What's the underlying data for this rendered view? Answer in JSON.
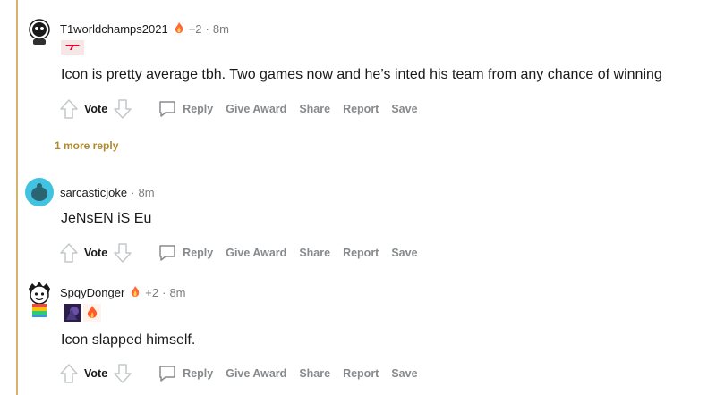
{
  "colors": {
    "thread_line": "#d6b46e",
    "more_reply": "#b08a2d",
    "meta_gray": "#7c7c7c",
    "action_gray": "#878a8c"
  },
  "comments": [
    {
      "username": "T1worldchamps2021",
      "award_icon": "fire-award-icon",
      "award_count": "+2",
      "time": "8m",
      "flair": [
        "t1-logo-flair-icon"
      ],
      "body": "Icon is pretty average tbh. Two games now and he’s inted his team from any chance of winning"
    },
    {
      "username": "sarcasticjoke",
      "time": "8m",
      "body": "JeNsEN iS Eu"
    },
    {
      "username": "SpqyDonger",
      "award_icon": "fire-award-icon",
      "award_count": "+2",
      "time": "8m",
      "flair": [
        "champion-portrait-flair-icon",
        "fire-flair-icon"
      ],
      "body": "Icon slapped himself."
    }
  ],
  "actions": {
    "vote": "Vote",
    "reply": "Reply",
    "give_award": "Give Award",
    "share": "Share",
    "report": "Report",
    "save": "Save"
  },
  "more_replies": "1 more reply",
  "separator": "·"
}
